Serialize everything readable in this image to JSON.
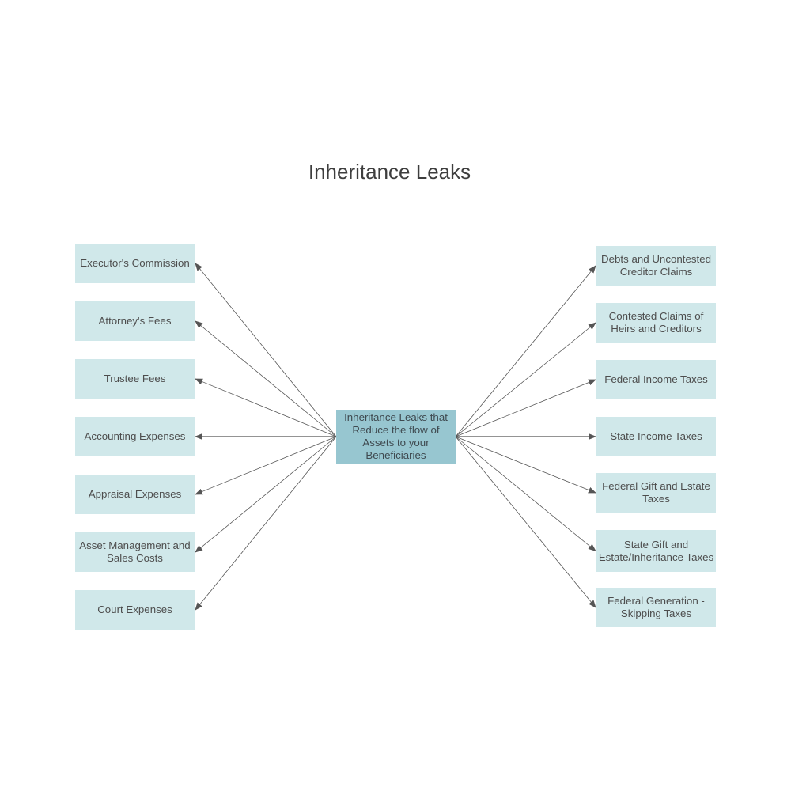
{
  "title": "Inheritance Leaks",
  "center_node": {
    "label": "Inheritance Leaks that Reduce the flow of Assets to your Beneficiaries"
  },
  "left_nodes": [
    {
      "label": "Executor's Commission"
    },
    {
      "label": "Attorney's Fees"
    },
    {
      "label": "Trustee Fees"
    },
    {
      "label": "Accounting Expenses"
    },
    {
      "label": "Appraisal Expenses"
    },
    {
      "label": "Asset Management and Sales Costs"
    },
    {
      "label": "Court Expenses"
    }
  ],
  "right_nodes": [
    {
      "label": "Debts and Uncontested Creditor Claims"
    },
    {
      "label": "Contested Claims of Heirs and Creditors"
    },
    {
      "label": "Federal Income Taxes"
    },
    {
      "label": "State Income Taxes"
    },
    {
      "label": "Federal Gift and Estate Taxes"
    },
    {
      "label": "State Gift and Estate/Inheritance Taxes"
    },
    {
      "label": "Federal Generation - Skipping Taxes"
    }
  ],
  "colors": {
    "node_fill": "#d0e8ea",
    "center_fill": "#97c6d0",
    "arrow": "#555555",
    "text": "#4d4d4d"
  }
}
